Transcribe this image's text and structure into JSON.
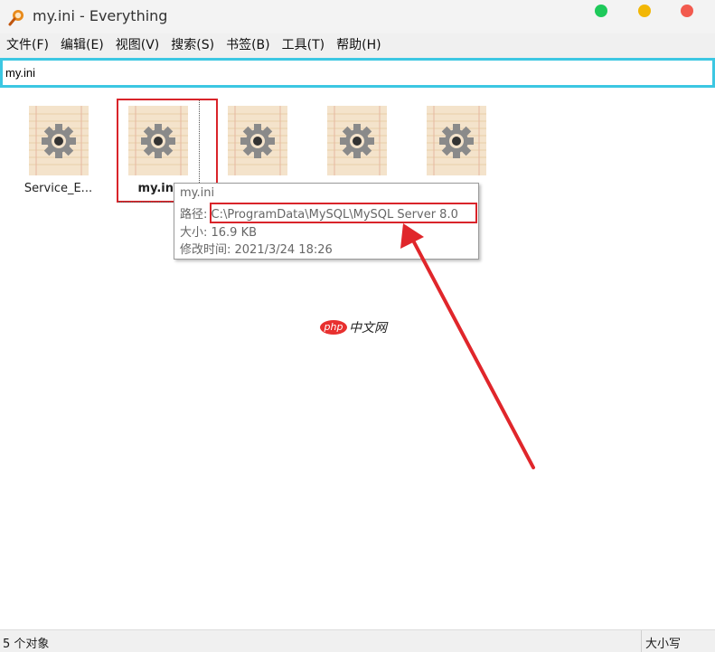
{
  "window": {
    "title": "my.ini - Everything",
    "controls": [
      {
        "name": "maximize",
        "color": "#1ec95a"
      },
      {
        "name": "minimize",
        "color": "#f2b705"
      },
      {
        "name": "close",
        "color": "#f25a4e"
      }
    ]
  },
  "menu": {
    "items": [
      "文件(F)",
      "编辑(E)",
      "视图(V)",
      "搜索(S)",
      "书签(B)",
      "工具(T)",
      "帮助(H)"
    ]
  },
  "search": {
    "value": "my.ini",
    "accent": "#3cc7e2"
  },
  "files": [
    {
      "name": "Service_E...",
      "icon": "ini-settings-icon",
      "selected": false
    },
    {
      "name": "my.ini",
      "icon": "ini-settings-icon",
      "selected": true
    },
    {
      "name": "",
      "icon": "ini-settings-icon",
      "selected": false
    },
    {
      "name": "",
      "icon": "ini-settings-icon",
      "selected": false
    },
    {
      "name": "",
      "icon": "ini-settings-icon",
      "selected": false
    }
  ],
  "tooltip": {
    "filename": "my.ini",
    "path_label": "路径: ",
    "path_value": "C:\\ProgramData\\MySQL\\MySQL Server 8.0",
    "size_line": "大小: 16.9 KB",
    "modified_line": "修改时间: 2021/3/24 18:26"
  },
  "watermark": {
    "badge": "php",
    "text": "中文网"
  },
  "annotation": {
    "color": "#d9242a"
  },
  "status": {
    "count": "5 个对象",
    "case": "大小写"
  }
}
